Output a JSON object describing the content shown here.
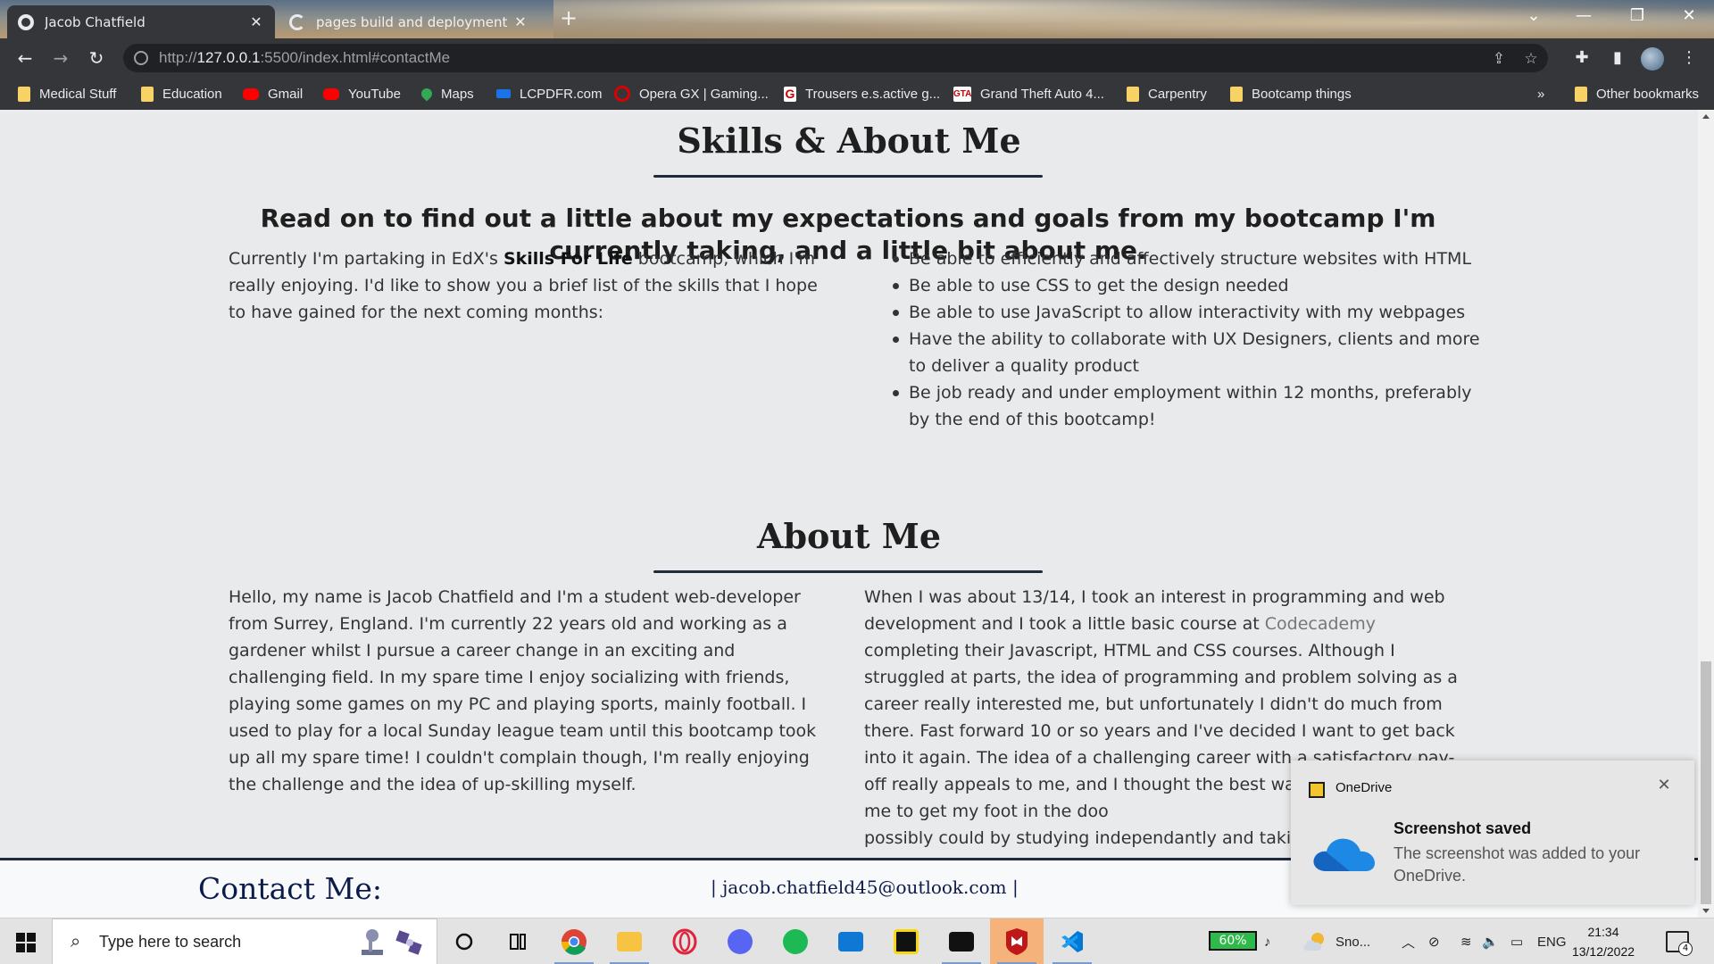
{
  "browser": {
    "tabs": [
      {
        "title": "Jacob Chatfield",
        "active": true
      },
      {
        "title": "pages build and deployment · jac",
        "active": false
      }
    ],
    "new_tab_label": "+",
    "window_controls": {
      "chevron": "⌄",
      "minimize": "—",
      "restore": "❐",
      "close": "✕"
    },
    "url_prefix": "http://",
    "url_host": "127.0.0.1",
    "url_rest": ":5500/index.html#contactMe",
    "bookmarks": [
      {
        "label": "Medical Stuff",
        "icon": "folder-icon"
      },
      {
        "label": "Education",
        "icon": "folder-icon"
      },
      {
        "label": "Gmail",
        "icon": "youtube-red-icon"
      },
      {
        "label": "YouTube",
        "icon": "youtube-icon"
      },
      {
        "label": "Maps",
        "icon": "maps-icon"
      },
      {
        "label": "LCPDFR.com",
        "icon": "lcpdfr-icon"
      },
      {
        "label": "Opera GX | Gaming...",
        "icon": "opera-icon"
      },
      {
        "label": "Trousers e.s.active g...",
        "icon": "g-icon"
      },
      {
        "label": "Grand Theft Auto 4...",
        "icon": "gta-icon"
      },
      {
        "label": "Carpentry",
        "icon": "folder-icon"
      },
      {
        "label": "Bootcamp things",
        "icon": "folder-icon"
      }
    ],
    "bookmarks_overflow": "»",
    "other_bookmarks": "Other bookmarks"
  },
  "page": {
    "skills_heading": "Skills & About Me",
    "lead_text": "Read on to find out a little about my expectations and goals from my bootcamp I'm currently taking, and a little bit about me.",
    "intro_before": "Currently I'm partaking in EdX's ",
    "intro_bold": "Skills For Life",
    "intro_after": " bootcamp, which I'm really enjoying. I'd like to show you a brief list of the skills that I hope to have gained for the next coming months:",
    "skills": [
      "Be able to efficiently and affectively structure websites with HTML",
      "Be able to use CSS to get the design needed",
      "Be able to use JavaScript to allow interactivity with my webpages",
      "Have the ability to collaborate with UX Designers, clients and more to deliver a quality product",
      "Be job ready and under employment within 12 months, preferably by the end of this bootcamp!"
    ],
    "about_heading": "About Me",
    "about_left": "Hello, my name is Jacob Chatfield and I'm a student web-developer from Surrey, England. I'm currently 22 years old and working as a gardener whilst I pursue a career change in an exciting and challenging field. In my spare time I enjoy socializing with friends, playing some games on my PC and playing sports, mainly football. I used to play for a local Sunday league team until this bootcamp took up all my spare time! I couldn't complain though, I'm really enjoying the challenge and the idea of up-skilling myself.",
    "about_right_before": "When I was about 13/14, I took an interest in programming and web development and I took a little basic course at ",
    "about_right_link": "Codecademy",
    "about_right_after": " completing their Javascript, HTML and CSS courses. Although I struggled at parts, the idea of programming and problem solving as a career really interested me, but unfortunately I didn't do much from there. Fast forward 10 or so years and I've decided I want to get back into it again. The idea of a challenging career with a satisfactory pay-off really appeals to me, and I thought the best way forward was for me to get my foot in the doo",
    "about_right_tail": "possibly could by studying independantly and taking s",
    "contact_title": "Contact Me:",
    "contact_email": "| jacob.chatfield45@outlook.com |"
  },
  "toast": {
    "app_name": "OneDrive",
    "title": "Screenshot saved",
    "body": "The screenshot was added to your OneDrive.",
    "close": "✕"
  },
  "taskbar": {
    "search_placeholder": "Type here to search",
    "battery": "60%",
    "weather": "Sno...",
    "language": "ENG",
    "time": "21:34",
    "date": "13/12/2022",
    "notification_count": "4"
  },
  "colors": {
    "page_bg": "#e9eaec",
    "heading_rule": "#1f2a3a",
    "contact_text": "#0d1b4a",
    "browser_toolbar": "#35363a"
  }
}
